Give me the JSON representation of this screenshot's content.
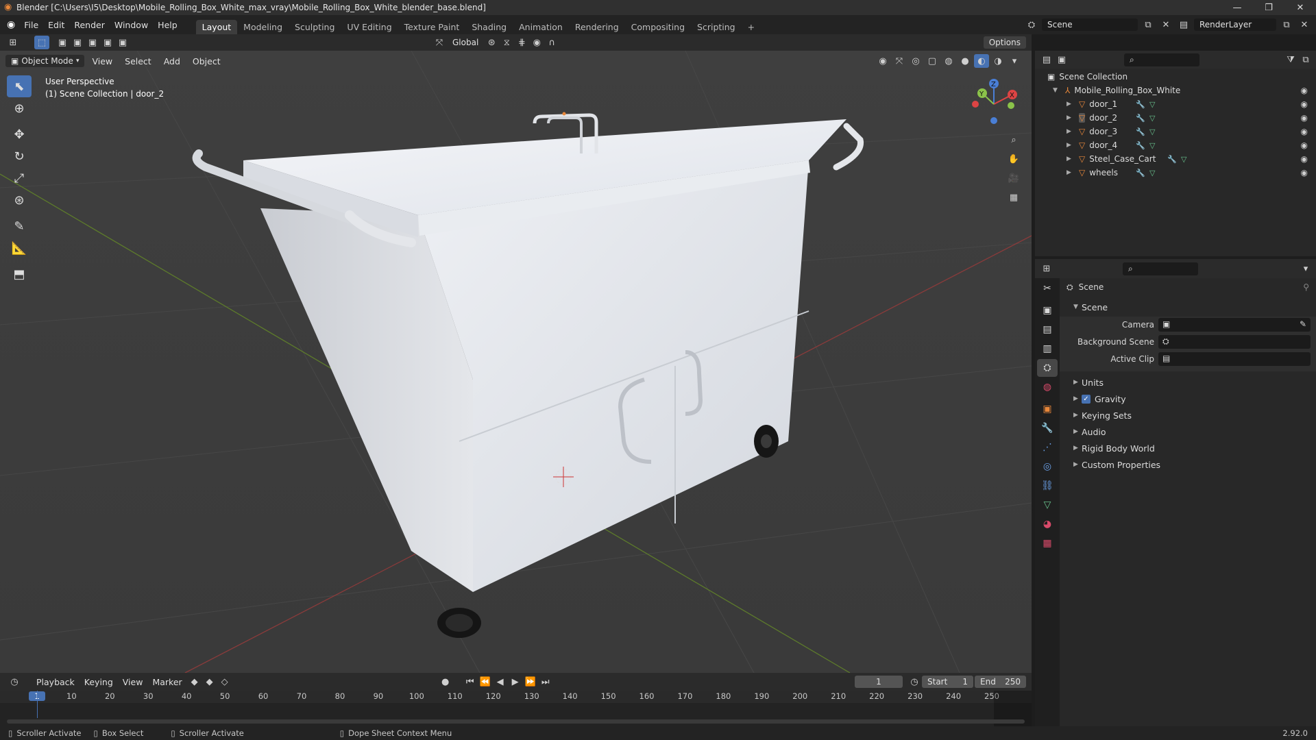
{
  "window": {
    "title": "Blender [C:\\Users\\I5\\Desktop\\Mobile_Rolling_Box_White_max_vray\\Mobile_Rolling_Box_White_blender_base.blend]"
  },
  "menu": [
    "File",
    "Edit",
    "Render",
    "Window",
    "Help"
  ],
  "workspaces": [
    "Layout",
    "Modeling",
    "Sculpting",
    "UV Editing",
    "Texture Paint",
    "Shading",
    "Animation",
    "Rendering",
    "Compositing",
    "Scripting"
  ],
  "active_workspace": "Layout",
  "scene_selector": "Scene",
  "view_layer": "RenderLayer",
  "toolbar": {
    "transform_orientation": "Global",
    "options_label": "Options"
  },
  "viewport_header": {
    "mode": "Object Mode",
    "menus": [
      "View",
      "Select",
      "Add",
      "Object"
    ]
  },
  "viewport": {
    "overlay_line1": "User Perspective",
    "overlay_line2": "(1) Scene Collection | door_2",
    "gizmo": {
      "x": "X",
      "y": "Y",
      "z": "Z"
    }
  },
  "outliner": {
    "root": "Scene Collection",
    "collection": "Mobile_Rolling_Box_White",
    "objects": [
      "door_1",
      "door_2",
      "door_3",
      "door_4",
      "Steel_Case_Cart",
      "wheels"
    ]
  },
  "properties": {
    "context": "Scene",
    "section": "Scene",
    "fields": {
      "camera": "Camera",
      "background_scene": "Background Scene",
      "active_clip": "Active Clip"
    },
    "panels": [
      "Units",
      "Gravity",
      "Keying Sets",
      "Audio",
      "Rigid Body World",
      "Custom Properties"
    ]
  },
  "timeline": {
    "menus": [
      "Playback",
      "Keying",
      "View",
      "Marker"
    ],
    "current_frame": "1",
    "start_label": "Start",
    "start": "1",
    "end_label": "End",
    "end": "250",
    "ticks": [
      "1",
      "10",
      "20",
      "30",
      "40",
      "50",
      "60",
      "70",
      "80",
      "90",
      "100",
      "110",
      "120",
      "130",
      "140",
      "150",
      "160",
      "170",
      "180",
      "190",
      "200",
      "210",
      "220",
      "230",
      "240",
      "250"
    ]
  },
  "statusbar": {
    "items": [
      "Scroller Activate",
      "Box Select",
      "Scroller Activate",
      "Dope Sheet Context Menu"
    ],
    "version": "2.92.0"
  },
  "colors": {
    "accent": "#4772b3",
    "object_orange": "#e8873a",
    "mesh_green": "#67c18c",
    "modifier_blue": "#6aa0e8"
  }
}
